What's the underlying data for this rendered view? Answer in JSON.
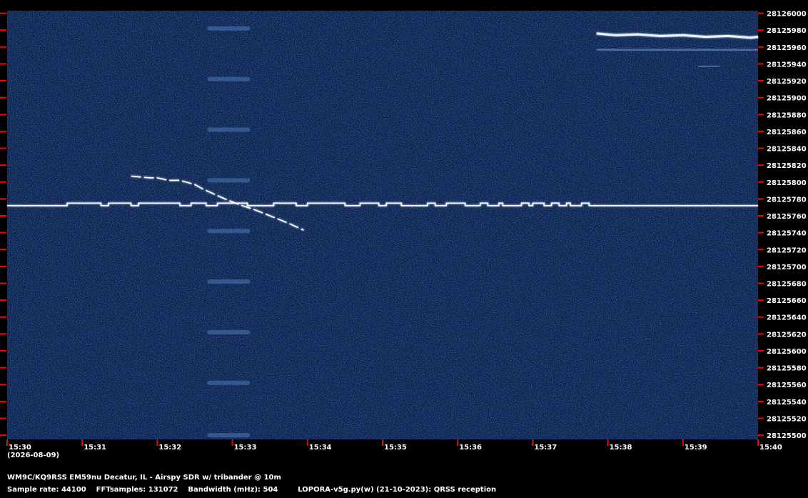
{
  "chart_data": {
    "type": "heatmap",
    "title": "",
    "xlabel": "",
    "ylabel": "",
    "x_ticks": [
      "15:30",
      "15:31",
      "15:32",
      "15:33",
      "15:34",
      "15:35",
      "15:36",
      "15:37",
      "15:38",
      "15:39",
      "15:40"
    ],
    "y_ticks": [
      28126000,
      28125980,
      28125960,
      28125940,
      28125920,
      28125900,
      28125880,
      28125860,
      28125840,
      28125820,
      28125800,
      28125780,
      28125760,
      28125740,
      28125720,
      28125700,
      28125680,
      28125660,
      28125640,
      28125620,
      28125600,
      28125580,
      28125560,
      28125540,
      28125520,
      28125500
    ],
    "xlim": [
      "15:30",
      "15:40"
    ],
    "ylim": [
      28125495,
      28126003
    ],
    "colors": {
      "background": "#0b1f4a",
      "signal": "#ffffff",
      "tick": "#ff0000"
    },
    "traces": [
      {
        "name": "",
        "points": [
          [
            0.0,
            28125772
          ],
          [
            0.8,
            28125772
          ],
          [
            0.8,
            28125775
          ],
          [
            1.25,
            28125775
          ],
          [
            1.25,
            28125772
          ],
          [
            1.35,
            28125772
          ],
          [
            1.35,
            28125775
          ],
          [
            1.65,
            28125775
          ],
          [
            1.65,
            28125772
          ],
          [
            1.75,
            28125772
          ],
          [
            1.75,
            28125775
          ],
          [
            2.3,
            28125775
          ],
          [
            2.3,
            28125772
          ],
          [
            2.45,
            28125772
          ],
          [
            2.45,
            28125775
          ],
          [
            2.65,
            28125775
          ],
          [
            2.65,
            28125772
          ],
          [
            2.8,
            28125772
          ],
          [
            2.8,
            28125775
          ],
          [
            3.2,
            28125775
          ],
          [
            3.2,
            28125772
          ],
          [
            3.55,
            28125772
          ],
          [
            3.55,
            28125775
          ],
          [
            3.85,
            28125775
          ],
          [
            3.85,
            28125772
          ],
          [
            4.0,
            28125772
          ],
          [
            4.0,
            28125775
          ],
          [
            4.5,
            28125775
          ],
          [
            4.5,
            28125772
          ],
          [
            4.7,
            28125772
          ],
          [
            4.7,
            28125775
          ],
          [
            4.95,
            28125775
          ],
          [
            4.95,
            28125772
          ],
          [
            5.05,
            28125772
          ],
          [
            5.05,
            28125775
          ],
          [
            5.25,
            28125775
          ],
          [
            5.25,
            28125772
          ],
          [
            5.6,
            28125772
          ],
          [
            5.6,
            28125775
          ],
          [
            5.7,
            28125775
          ],
          [
            5.7,
            28125772
          ],
          [
            5.85,
            28125772
          ],
          [
            5.85,
            28125775
          ],
          [
            6.1,
            28125775
          ],
          [
            6.1,
            28125772
          ],
          [
            6.3,
            28125772
          ],
          [
            6.3,
            28125775
          ],
          [
            6.4,
            28125775
          ],
          [
            6.4,
            28125772
          ],
          [
            6.55,
            28125772
          ],
          [
            6.55,
            28125775
          ],
          [
            6.6,
            28125775
          ],
          [
            6.6,
            28125772
          ],
          [
            6.85,
            28125772
          ],
          [
            6.85,
            28125775
          ],
          [
            6.95,
            28125775
          ],
          [
            6.95,
            28125772
          ],
          [
            7.0,
            28125772
          ],
          [
            7.0,
            28125775
          ],
          [
            7.15,
            28125775
          ],
          [
            7.15,
            28125772
          ],
          [
            7.25,
            28125772
          ],
          [
            7.25,
            28125775
          ],
          [
            7.35,
            28125775
          ],
          [
            7.35,
            28125772
          ],
          [
            7.45,
            28125772
          ],
          [
            7.45,
            28125775
          ],
          [
            7.5,
            28125775
          ],
          [
            7.5,
            28125772
          ],
          [
            7.65,
            28125772
          ],
          [
            7.65,
            28125775
          ],
          [
            7.75,
            28125775
          ],
          [
            7.75,
            28125772
          ],
          [
            10.0,
            28125772
          ]
        ]
      },
      {
        "name": "",
        "points": [
          [
            1.65,
            28125807
          ],
          [
            1.9,
            28125805
          ],
          [
            2.0,
            28125805
          ],
          [
            2.15,
            28125802
          ],
          [
            2.3,
            28125802
          ],
          [
            2.5,
            28125797
          ],
          [
            2.6,
            28125792
          ],
          [
            2.75,
            28125786
          ],
          [
            2.9,
            28125780
          ],
          [
            3.1,
            28125773
          ],
          [
            3.3,
            28125767
          ],
          [
            3.5,
            28125760
          ],
          [
            3.75,
            28125751
          ],
          [
            3.95,
            28125743
          ]
        ]
      },
      {
        "name": "",
        "points": [
          [
            7.85,
            28125976
          ],
          [
            8.1,
            28125974
          ],
          [
            8.4,
            28125975
          ],
          [
            8.7,
            28125973
          ],
          [
            9.0,
            28125974
          ],
          [
            9.3,
            28125972
          ],
          [
            9.6,
            28125973
          ],
          [
            9.9,
            28125971
          ],
          [
            10.0,
            28125972
          ]
        ]
      }
    ]
  },
  "footer": {
    "line1": "WM9C/KQ9RSS EM59nu Decatur, IL - Airspy SDR w/ tribander @ 10m",
    "line2": "Sample rate: 44100    FFTsamples: 131072    Bandwidth (mHz): 504        LOPORA-v5g.py(w) (21-10-2023): QRSS reception"
  },
  "date_label": "(2026-08-09)"
}
